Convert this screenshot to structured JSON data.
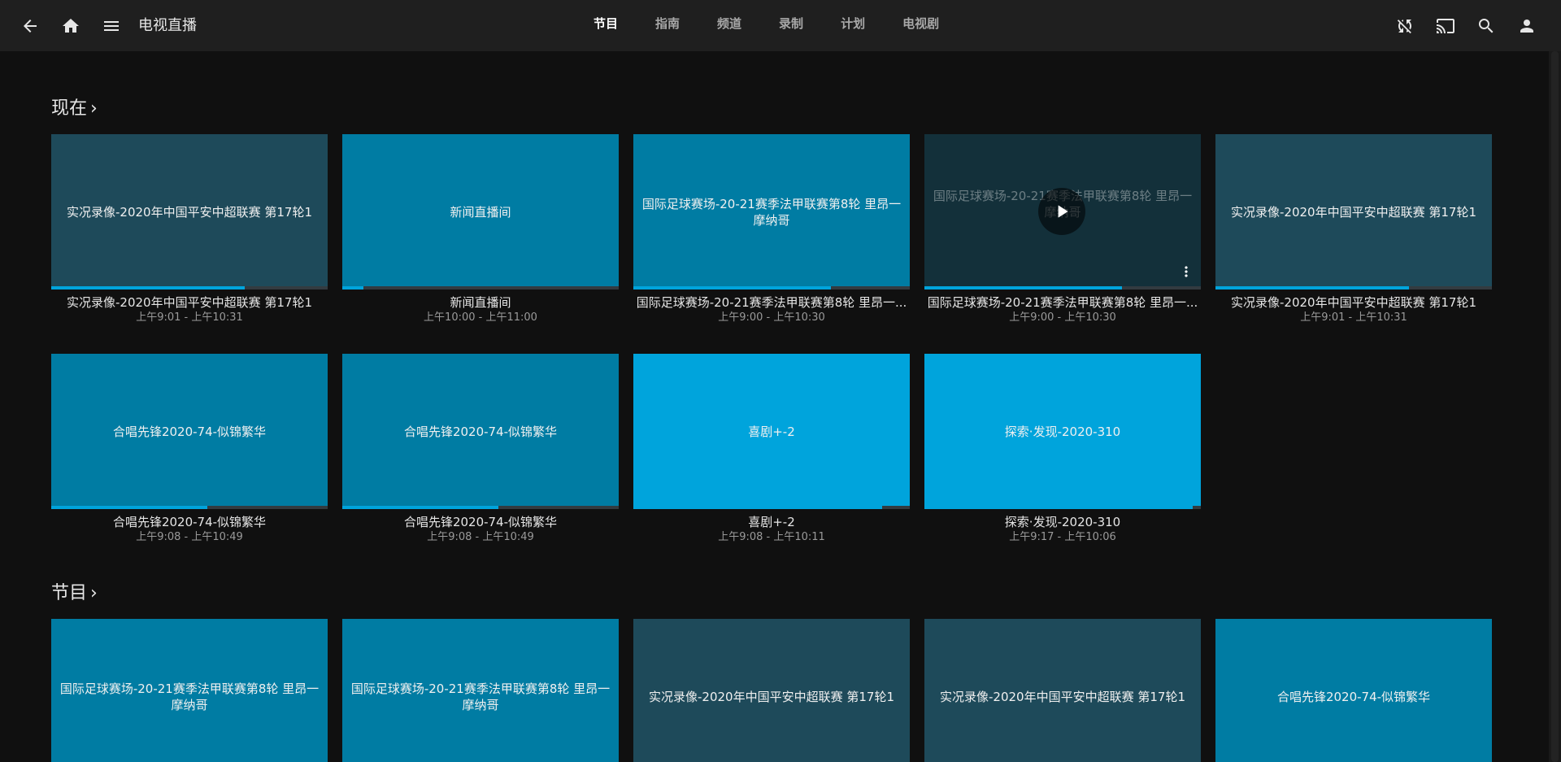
{
  "header": {
    "title": "电视直播",
    "tabs": [
      {
        "label": "节目",
        "active": true
      },
      {
        "label": "指南",
        "active": false
      },
      {
        "label": "频道",
        "active": false
      },
      {
        "label": "录制",
        "active": false
      },
      {
        "label": "计划",
        "active": false
      },
      {
        "label": "电视剧",
        "active": false
      }
    ],
    "icons": [
      "back-arrow-icon",
      "home-icon",
      "menu-icon",
      "sync-disabled-icon",
      "cast-icon",
      "search-icon",
      "user-icon"
    ]
  },
  "colors": {
    "header_bg": "#1f1f1f",
    "page_bg": "#101010",
    "accent": "#00a4dc",
    "thumb_slate": "#1e4a5a",
    "thumb_teal": "#007ca3",
    "thumb_sky": "#00a4dc"
  },
  "sections": [
    {
      "title": "现在",
      "chevron": "›",
      "cards": [
        {
          "thumb": "实况录像-2020年中国平安中超联赛 第17轮1",
          "title": "实况录像-2020年中国平安中超联赛 第17轮1",
          "time": "上午9:01 - 上午10:31",
          "color": "#1e4a5a",
          "progress": 0.7
        },
        {
          "thumb": "新闻直播间",
          "title": "新闻直播间",
          "time": "上午10:00 - 上午11:00",
          "color": "#007ca3",
          "progress": 0.075
        },
        {
          "thumb": "国际足球赛场-20-21赛季法甲联赛第8轮 里昂一摩纳哥",
          "title": "国际足球赛场-20-21赛季法甲联赛第8轮 里昂一...",
          "time": "上午9:00 - 上午10:30",
          "color": "#007ca3",
          "progress": 0.715
        },
        {
          "thumb": "国际足球赛场-20-21赛季法甲联赛第8轮 里昂一摩纳哥",
          "title": "国际足球赛场-20-21赛季法甲联赛第8轮 里昂一...",
          "time": "上午9:00 - 上午10:30",
          "color": "#1e4a5a",
          "progress": 0.715,
          "hovered": true
        },
        {
          "thumb": "实况录像-2020年中国平安中超联赛 第17轮1",
          "title": "实况录像-2020年中国平安中超联赛 第17轮1",
          "time": "上午9:01 - 上午10:31",
          "color": "#1e4a5a",
          "progress": 0.7
        },
        {
          "thumb": "合唱先锋2020-74-似锦繁华",
          "title": "合唱先锋2020-74-似锦繁华",
          "time": "上午9:08 - 上午10:49",
          "color": "#007ca3",
          "progress": 0.565
        },
        {
          "thumb": "合唱先锋2020-74-似锦繁华",
          "title": "合唱先锋2020-74-似锦繁华",
          "time": "上午9:08 - 上午10:49",
          "color": "#007ca3",
          "progress": 0.565
        },
        {
          "thumb": "喜剧+-2",
          "title": "喜剧+-2",
          "time": "上午9:08 - 上午10:11",
          "color": "#00a4dc",
          "progress": 0.9
        },
        {
          "thumb": "探索·发现-2020-310",
          "title": "探索·发现-2020-310",
          "time": "上午9:17 - 上午10:06",
          "color": "#00a4dc",
          "progress": 0.97
        }
      ]
    },
    {
      "title": "节目",
      "chevron": "›",
      "cards": [
        {
          "thumb": "国际足球赛场-20-21赛季法甲联赛第8轮 里昂一摩纳哥",
          "color": "#007ca3"
        },
        {
          "thumb": "国际足球赛场-20-21赛季法甲联赛第8轮 里昂一摩纳哥",
          "color": "#007ca3"
        },
        {
          "thumb": "实况录像-2020年中国平安中超联赛 第17轮1",
          "color": "#1e4a5a"
        },
        {
          "thumb": "实况录像-2020年中国平安中超联赛 第17轮1",
          "color": "#1e4a5a"
        },
        {
          "thumb": "合唱先锋2020-74-似锦繁华",
          "color": "#007ca3"
        }
      ]
    }
  ]
}
